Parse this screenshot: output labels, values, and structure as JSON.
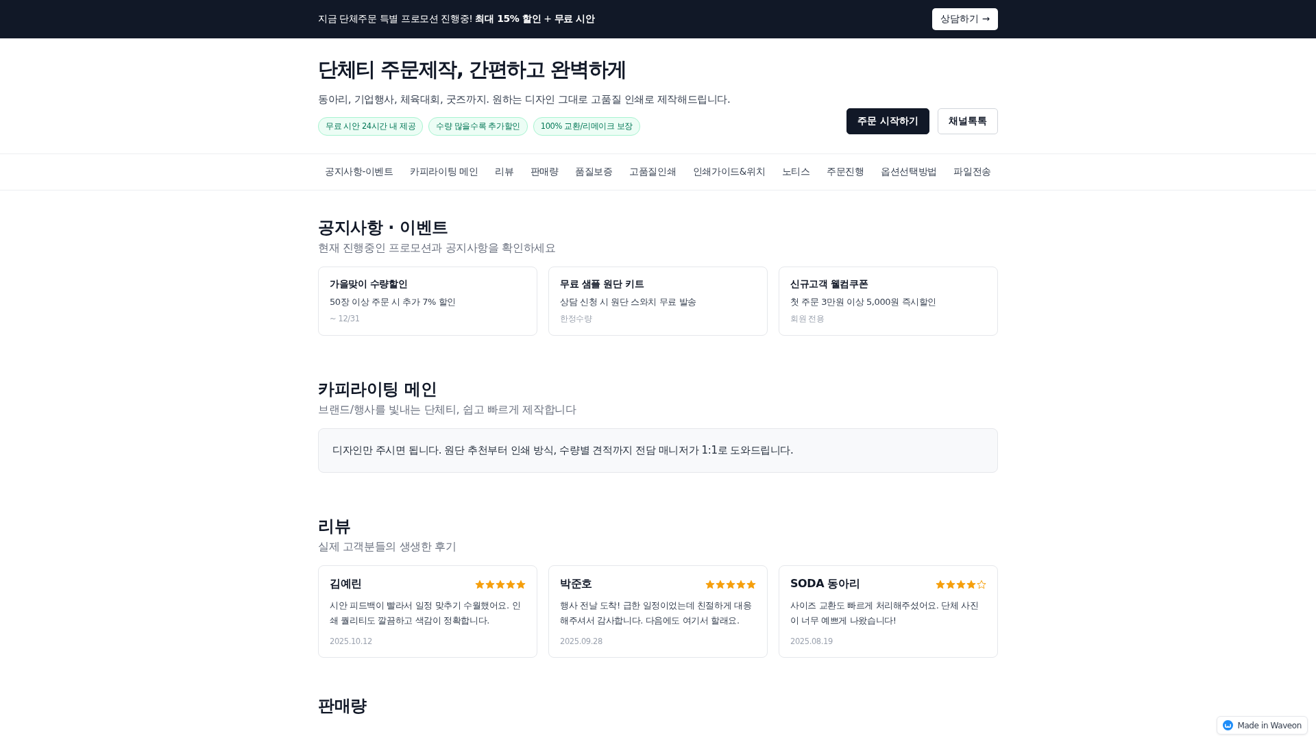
{
  "promo_bar": {
    "text": "지금 단체주문 특별 프로모션 진행중! **최대 15% 할인** + **무료 시안**",
    "button": "상담하기 →"
  },
  "hero": {
    "title": "단체티 주문제작, 간편하고 완벽하게",
    "subtitle": "동아리, 기업행사, 체육대회, 굿즈까지. 원하는 디자인 그대로 고품질 인쇄로 제작해드립니다.",
    "badges": [
      "무료 시안 24시간 내 제공",
      "수량 많을수록 추가할인",
      "100% 교환/리메이크 보장"
    ],
    "buttons": [
      {
        "label": "주문 시작하기",
        "kind": "primary"
      },
      {
        "label": "채널톡톡",
        "kind": "secondary"
      }
    ]
  },
  "nav": [
    "공지사항-이벤트",
    "카피라이팅 메인",
    "리뷰",
    "판매량",
    "품질보증",
    "고품질인쇄",
    "인쇄가이드&위치",
    "노티스",
    "주문진행",
    "옵션선택방법",
    "파일전송"
  ],
  "notices": {
    "title": "공지사항 · 이벤트",
    "subtitle": "현재 진행중인 프로모션과 공지사항을 확인하세요",
    "cards": [
      {
        "title": "가을맞이 수량할인",
        "text": "50장 이상 주문 시 추가 7% 할인",
        "meta": "~ 12/31"
      },
      {
        "title": "무료 샘플 원단 키트",
        "text": "상담 신청 시 원단 스와치 무료 발송",
        "meta": "한정수량"
      },
      {
        "title": "신규고객 웰컴쿠폰",
        "text": "첫 주문 3만원 이상 5,000원 즉시할인",
        "meta": "회원 전용"
      }
    ]
  },
  "copywriting": {
    "title": "카피라이팅 메인",
    "subtitle": "브랜드/행사를 빛내는 단체티, 쉽고 빠르게 제작합니다",
    "text": "디자인만 주시면 됩니다. 원단 추천부터 인쇄 방식, 수량별 견적까지 전담 매니저가 1:1로 도와드립니다."
  },
  "reviews": {
    "title": "리뷰",
    "subtitle": "실제 고객분들의 생생한 후기",
    "items": [
      {
        "name": "김예린",
        "stars": 5,
        "text": "시안 피드백이 빨라서 일정 맞추기 수월했어요. 인쇄 퀄리티도 깔끔하고 색감이 정확합니다.",
        "date": "2025.10.12"
      },
      {
        "name": "박준호",
        "stars": 5,
        "text": "행사 전날 도착! 급한 일정이었는데 친절하게 대응해주셔서 감사합니다. 다음에도 여기서 할래요.",
        "date": "2025.09.28"
      },
      {
        "name": "SODA 동아리",
        "stars": 4,
        "text": "사이즈 교환도 빠르게 처리해주셨어요. 단체 사진이 너무 예쁘게 나왔습니다!",
        "date": "2025.08.19"
      }
    ]
  },
  "sales": {
    "title": "판매량"
  },
  "badge": {
    "label": "Made in Waveon"
  }
}
